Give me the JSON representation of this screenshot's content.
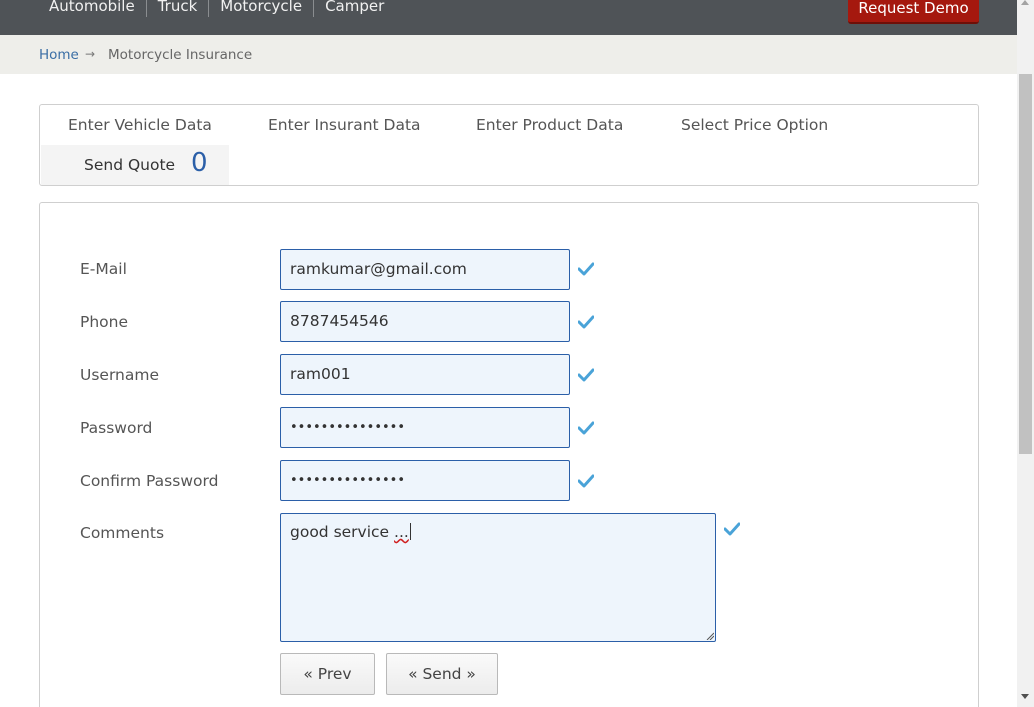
{
  "topnav": {
    "items": [
      "Automobile",
      "Truck",
      "Motorcycle",
      "Camper"
    ],
    "request_demo": "Request Demo"
  },
  "breadcrumb": {
    "home": "Home",
    "separator": "→",
    "current": "Motorcycle Insurance"
  },
  "steps": {
    "vehicle": "Enter Vehicle Data",
    "insurant": "Enter Insurant Data",
    "product": "Enter Product Data",
    "price": "Select Price Option",
    "send": "Send Quote",
    "send_count": "0"
  },
  "form": {
    "email": {
      "label": "E-Mail",
      "value": "ramkumar@gmail.com"
    },
    "phone": {
      "label": "Phone",
      "value": "8787454546"
    },
    "username": {
      "label": "Username",
      "value": "ram001"
    },
    "password": {
      "label": "Password",
      "value": "•••••••••••••••"
    },
    "confirm_password": {
      "label": "Confirm Password",
      "value": "•••••••••••••••"
    },
    "comments": {
      "label": "Comments",
      "value_text": "good service ",
      "value_flagged": "..."
    }
  },
  "buttons": {
    "prev": "« Prev",
    "send": "« Send »"
  },
  "colors": {
    "nav_bg": "#4f5357",
    "demo_btn": "#a5180e",
    "field_border": "#2b5fa8",
    "field_bg": "#eef5fc",
    "check": "#4aa3d8"
  },
  "icons": {
    "valid": "checkmark-icon",
    "breadcrumb_separator": "arrow-right-icon"
  }
}
